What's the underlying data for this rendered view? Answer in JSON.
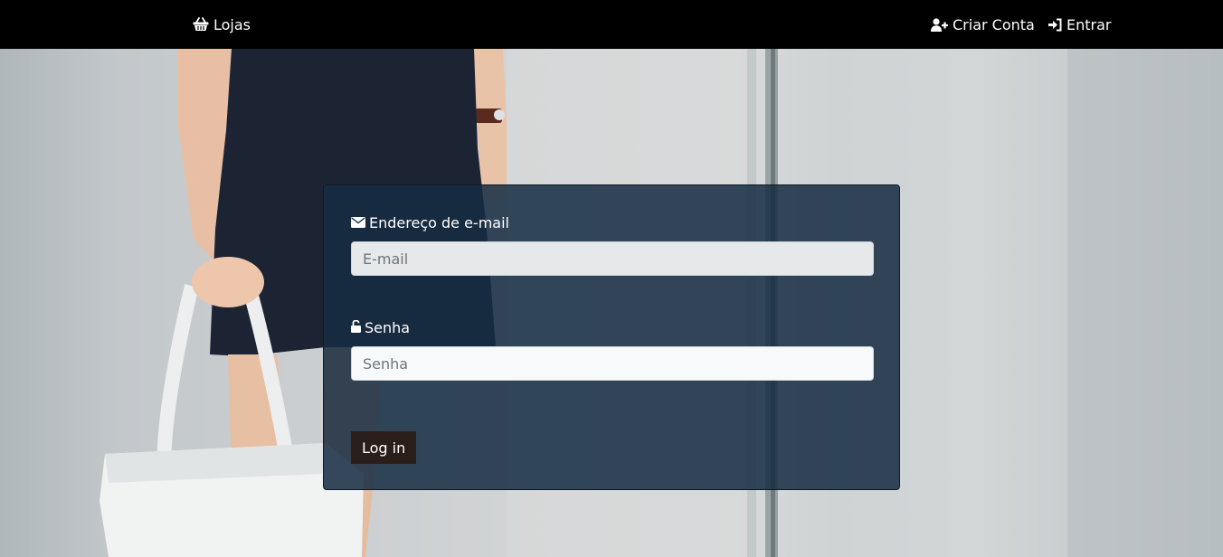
{
  "nav": {
    "brand": {
      "label": "Lojas",
      "icon": "basket-icon"
    },
    "links": [
      {
        "label": "Criar Conta",
        "icon": "user-plus-icon"
      },
      {
        "label": "Entrar",
        "icon": "sign-in-icon"
      }
    ]
  },
  "login_form": {
    "email": {
      "label": "Endereço de e-mail",
      "icon": "envelope-icon",
      "placeholder": "E-mail",
      "value": ""
    },
    "password": {
      "label": "Senha",
      "icon": "unlock-icon",
      "placeholder": "Senha",
      "value": ""
    },
    "submit_label": "Log in"
  },
  "colors": {
    "navbar": "#000000",
    "panel": "#162c42",
    "button": "#2a1e1a",
    "text": "#ffffff"
  }
}
